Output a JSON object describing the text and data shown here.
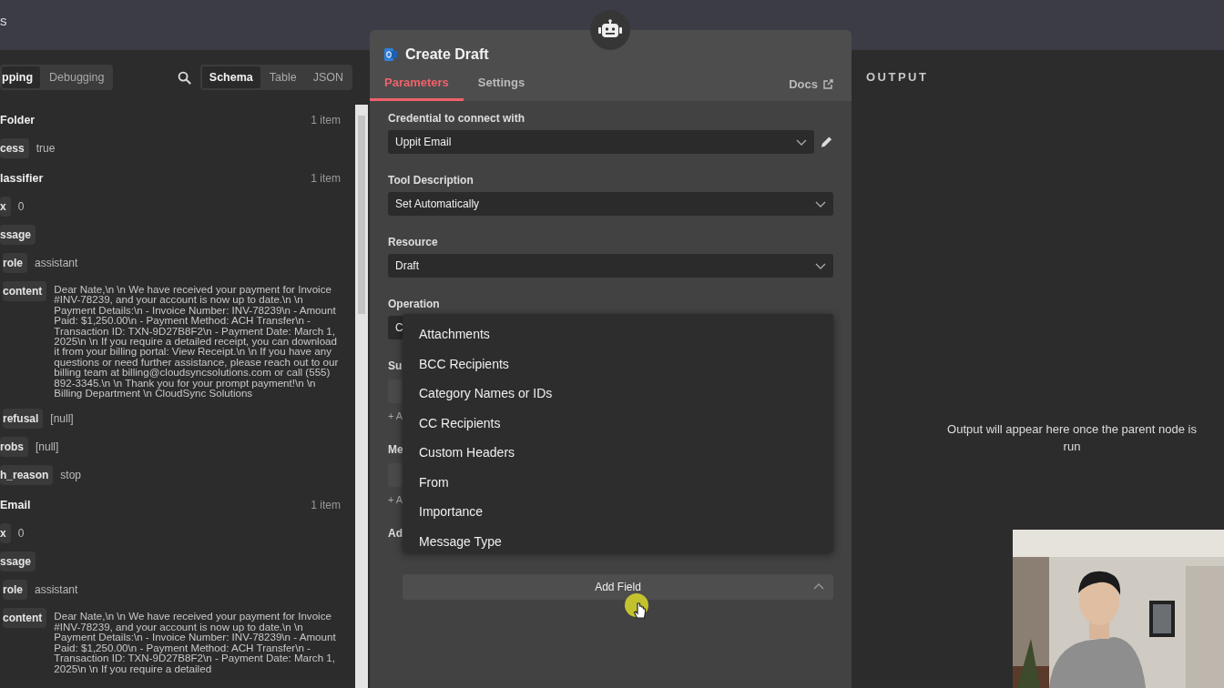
{
  "window": {
    "title": "s"
  },
  "input_panel": {
    "mode_tabs": [
      {
        "label": "pping",
        "selected": true
      },
      {
        "label": "Debugging",
        "selected": false
      }
    ],
    "view_tabs": [
      {
        "label": "Schema",
        "selected": true
      },
      {
        "label": "Table",
        "selected": false
      },
      {
        "label": "JSON",
        "selected": false
      }
    ],
    "tree": [
      {
        "kind": "node",
        "name": "Folder",
        "count": "1 item",
        "children": [
          {
            "kind": "field",
            "key": "cess",
            "value": "true"
          }
        ]
      },
      {
        "kind": "node",
        "name": "lassifier",
        "count": "1 item",
        "children": [
          {
            "kind": "field",
            "key": "x",
            "value": "0"
          },
          {
            "kind": "field",
            "key": "ssage",
            "children": [
              {
                "kind": "field",
                "key": "role",
                "value": "assistant"
              },
              {
                "kind": "text",
                "key": "content",
                "value": "Dear Nate,\\n \\n We have received your payment for Invoice #INV-78239, and your account is now up to date.\\n \\n Payment Details:\\n - Invoice Number: INV-78239\\n - Amount Paid: $1,250.00\\n - Payment Method: ACH Transfer\\n - Transaction ID: TXN-9D27B8F2\\n - Payment Date: March 1, 2025\\n \\n If you require a detailed receipt, you can download it from your billing portal: View Receipt.\\n \\n If you have any questions or need further assistance, please reach out to our billing team at billing@cloudsyncsolutions.com or call (555) 892-3345.\\n \\n Thank you for your prompt payment!\\n \\n Billing Department \\n CloudSync Solutions"
              },
              {
                "kind": "field",
                "key": "refusal",
                "value": "[null]"
              }
            ]
          },
          {
            "kind": "field",
            "key": "robs",
            "value": "[null]"
          },
          {
            "kind": "field",
            "key": "h_reason",
            "value": "stop"
          }
        ]
      },
      {
        "kind": "node",
        "name": "Email",
        "count": "1 item",
        "children": [
          {
            "kind": "field",
            "key": "x",
            "value": "0"
          },
          {
            "kind": "field",
            "key": "ssage",
            "children": [
              {
                "kind": "field",
                "key": "role",
                "value": "assistant"
              },
              {
                "kind": "text",
                "key": "content",
                "value": "Dear Nate,\\n \\n We have received your payment for Invoice #INV-78239, and your account is now up to date.\\n \\n Payment Details:\\n - Invoice Number: INV-78239\\n - Amount Paid: $1,250.00\\n - Payment Method: ACH Transfer\\n - Transaction ID: TXN-9D27B8F2\\n - Payment Date: March 1, 2025\\n \\n If you require a detailed"
              }
            ]
          }
        ]
      }
    ]
  },
  "node_panel": {
    "title": "Create Draft",
    "tabs": [
      {
        "label": "Parameters",
        "selected": true
      },
      {
        "label": "Settings",
        "selected": false
      }
    ],
    "docs": "Docs",
    "parameters": [
      {
        "label": "Credential to connect with",
        "value": "Uppit Email",
        "editable": true
      },
      {
        "label": "Tool Description",
        "value": "Set Automatically",
        "editable": false
      },
      {
        "label": "Resource",
        "value": "Draft",
        "editable": false
      },
      {
        "label": "Operation",
        "value": "C",
        "editable": false
      }
    ],
    "covered_fields": [
      {
        "kind": "label",
        "text": "Su"
      },
      {
        "kind": "input"
      },
      {
        "kind": "add",
        "text": "+ A"
      },
      {
        "kind": "label",
        "text": "Me"
      },
      {
        "kind": "input"
      },
      {
        "kind": "add",
        "text": "+ A"
      },
      {
        "kind": "label",
        "text": "Ad"
      }
    ],
    "dropdown_options": [
      "Attachments",
      "BCC Recipients",
      "Category Names or IDs",
      "CC Recipients",
      "Custom Headers",
      "From",
      "Importance",
      "Message Type"
    ],
    "add_field": {
      "label": "Add Field",
      "expanded": true
    }
  },
  "output_panel": {
    "title": "OUTPUT",
    "message": "Output will appear here once the parent node is run"
  }
}
